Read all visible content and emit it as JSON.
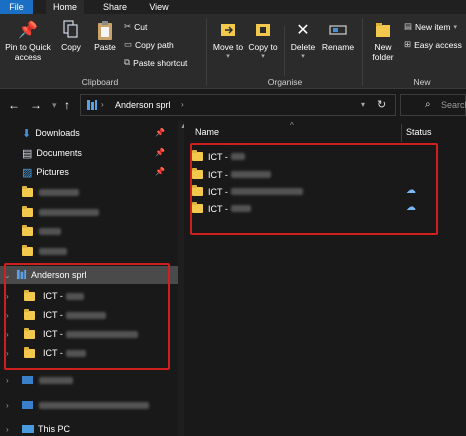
{
  "ribbon": {
    "tabs": [
      "File",
      "Home",
      "Share",
      "View"
    ],
    "clipboard": {
      "pin_label": "Pin to Quick access",
      "copy_label": "Copy",
      "paste_label": "Paste",
      "cut_label": "Cut",
      "copy_path_label": "Copy path",
      "paste_shortcut_label": "Paste shortcut",
      "group_label": "Clipboard"
    },
    "organise": {
      "move_to_label": "Move to",
      "copy_to_label": "Copy to",
      "delete_label": "Delete",
      "rename_label": "Rename",
      "group_label": "Organise"
    },
    "new": {
      "new_folder_label": "New folder",
      "new_item_label": "New item",
      "easy_access_label": "Easy access",
      "group_label": "New"
    }
  },
  "address": {
    "path": "Anderson sprl",
    "search_placeholder": "Search"
  },
  "nav_pane": {
    "quick_access": [
      "Downloads",
      "Documents",
      "Pictures"
    ],
    "current_library": "Anderson sprl",
    "library_children": [
      "ICT -",
      "ICT -",
      "ICT -",
      "ICT -"
    ],
    "bottom": "This PC"
  },
  "content": {
    "columns": [
      "Name",
      "Status"
    ],
    "files": [
      "ICT -",
      "ICT -",
      "ICT -",
      "ICT -"
    ]
  },
  "colors": {
    "file_tab": "#1a6fc4",
    "folder": "#f2c94c",
    "highlight_box": "#d01f1f",
    "cloud_status": "#7ab8f5"
  }
}
